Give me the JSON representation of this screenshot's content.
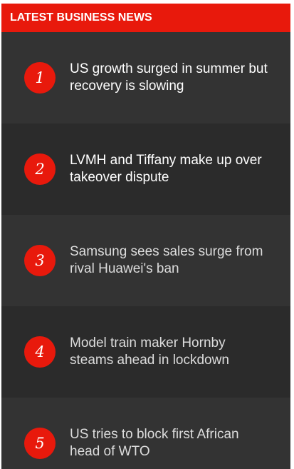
{
  "widget": {
    "title": "LATEST BUSINESS NEWS",
    "accent_color": "#e8190c",
    "items": [
      {
        "rank": "1",
        "headline": "US growth surged in summer but recovery is slowing"
      },
      {
        "rank": "2",
        "headline": "LVMH and Tiffany make up over takeover dispute"
      },
      {
        "rank": "3",
        "headline": "Samsung sees sales surge from rival Huawei's ban"
      },
      {
        "rank": "4",
        "headline": "Model train maker Hornby steams ahead in lockdown"
      },
      {
        "rank": "5",
        "headline": "US tries to block first African head of WTO"
      }
    ]
  }
}
